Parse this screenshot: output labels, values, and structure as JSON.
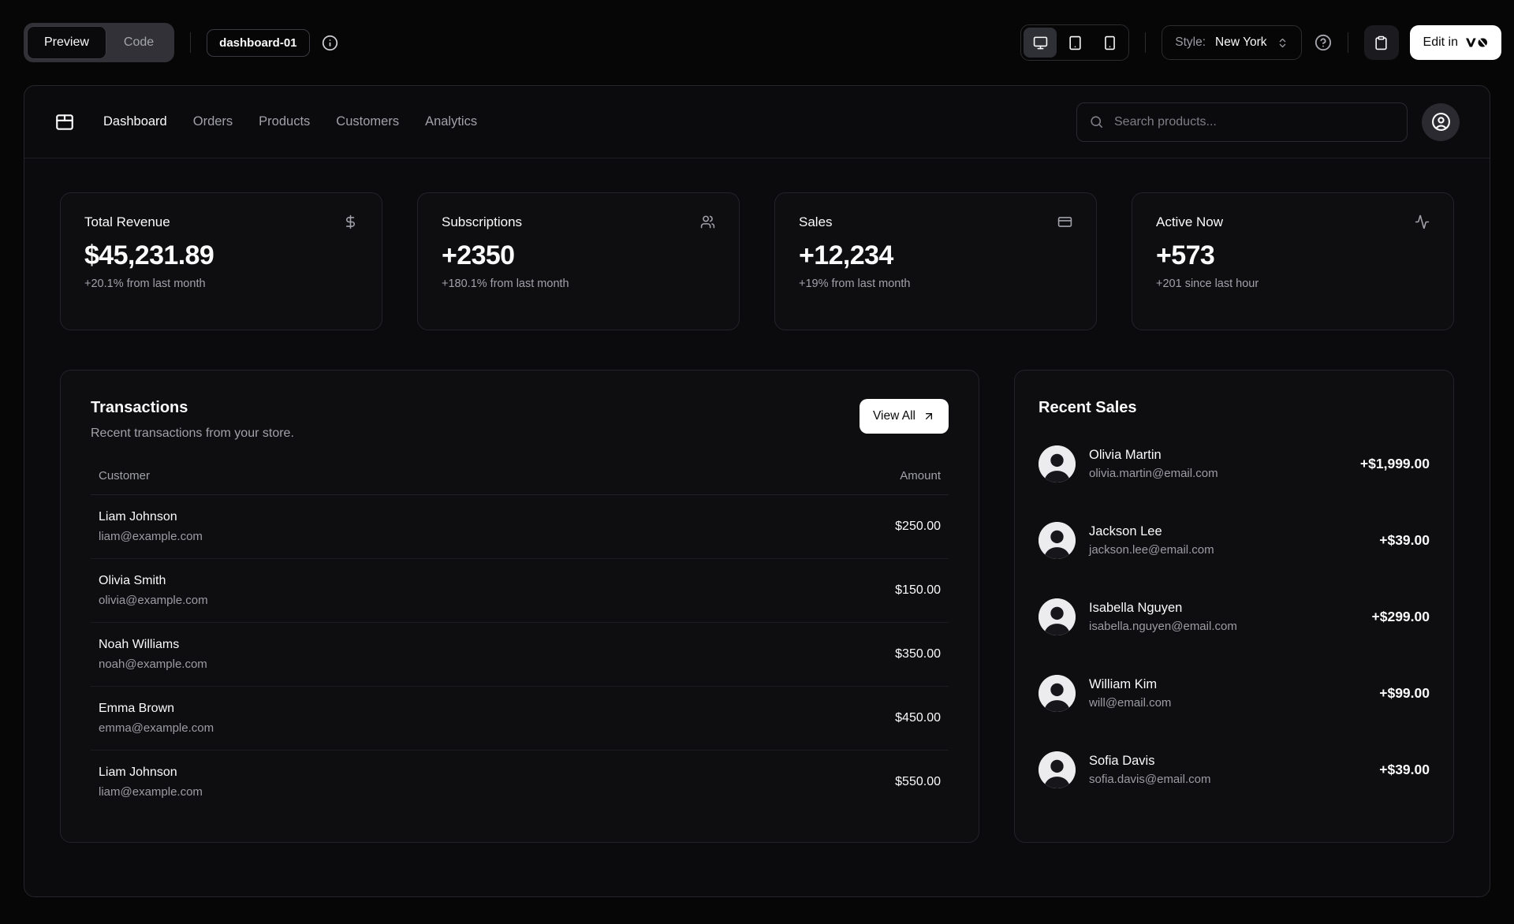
{
  "toolbar": {
    "view_tabs": [
      {
        "label": "Preview",
        "active": true
      },
      {
        "label": "Code",
        "active": false
      }
    ],
    "block_name": "dashboard-01",
    "info_icon": "info-icon",
    "device_toggles": [
      {
        "icon": "monitor-icon",
        "active": true
      },
      {
        "icon": "tablet-icon",
        "active": false
      },
      {
        "icon": "smartphone-icon",
        "active": false
      }
    ],
    "style_selector": {
      "label": "Style:",
      "value": "New York",
      "icon": "chevrons-up-down-icon"
    },
    "help_icon": "circle-help-icon",
    "copy_icon": "clipboard-icon",
    "edit_button": {
      "label": "Edit in",
      "logo": "v0-logo"
    }
  },
  "dashboard": {
    "nav": {
      "logo_icon": "package-icon",
      "items": [
        {
          "label": "Dashboard",
          "active": true
        },
        {
          "label": "Orders",
          "active": false
        },
        {
          "label": "Products",
          "active": false
        },
        {
          "label": "Customers",
          "active": false
        },
        {
          "label": "Analytics",
          "active": false
        }
      ],
      "search": {
        "icon": "search-icon",
        "placeholder": "Search products..."
      },
      "account_icon": "user-circle-icon"
    },
    "stats": [
      {
        "title": "Total Revenue",
        "icon": "dollar-sign-icon",
        "value": "$45,231.89",
        "change": "+20.1% from last month"
      },
      {
        "title": "Subscriptions",
        "icon": "users-icon",
        "value": "+2350",
        "change": "+180.1% from last month"
      },
      {
        "title": "Sales",
        "icon": "credit-card-icon",
        "value": "+12,234",
        "change": "+19% from last month"
      },
      {
        "title": "Active Now",
        "icon": "activity-icon",
        "value": "+573",
        "change": "+201 since last hour"
      }
    ],
    "transactions": {
      "title": "Transactions",
      "subtitle": "Recent transactions from your store.",
      "view_all": {
        "label": "View All",
        "icon": "arrow-up-right-icon"
      },
      "columns": {
        "customer": "Customer",
        "amount": "Amount"
      },
      "rows": [
        {
          "name": "Liam Johnson",
          "email": "liam@example.com",
          "amount": "$250.00"
        },
        {
          "name": "Olivia Smith",
          "email": "olivia@example.com",
          "amount": "$150.00"
        },
        {
          "name": "Noah Williams",
          "email": "noah@example.com",
          "amount": "$350.00"
        },
        {
          "name": "Emma Brown",
          "email": "emma@example.com",
          "amount": "$450.00"
        },
        {
          "name": "Liam Johnson",
          "email": "liam@example.com",
          "amount": "$550.00"
        }
      ]
    },
    "recent_sales": {
      "title": "Recent Sales",
      "items": [
        {
          "name": "Olivia Martin",
          "email": "olivia.martin@email.com",
          "amount": "+$1,999.00"
        },
        {
          "name": "Jackson Lee",
          "email": "jackson.lee@email.com",
          "amount": "+$39.00"
        },
        {
          "name": "Isabella Nguyen",
          "email": "isabella.nguyen@email.com",
          "amount": "+$299.00"
        },
        {
          "name": "William Kim",
          "email": "will@email.com",
          "amount": "+$99.00"
        },
        {
          "name": "Sofia Davis",
          "email": "sofia.davis@email.com",
          "amount": "+$39.00"
        }
      ]
    }
  },
  "colors": {
    "page_background": "#060607",
    "panel_background": "#0b0b0d",
    "card_background": "#0e0e11",
    "border": "#26262b",
    "text_primary": "#fafafa",
    "text_muted": "#a1a1aa",
    "primary_button": "#ffffff"
  }
}
